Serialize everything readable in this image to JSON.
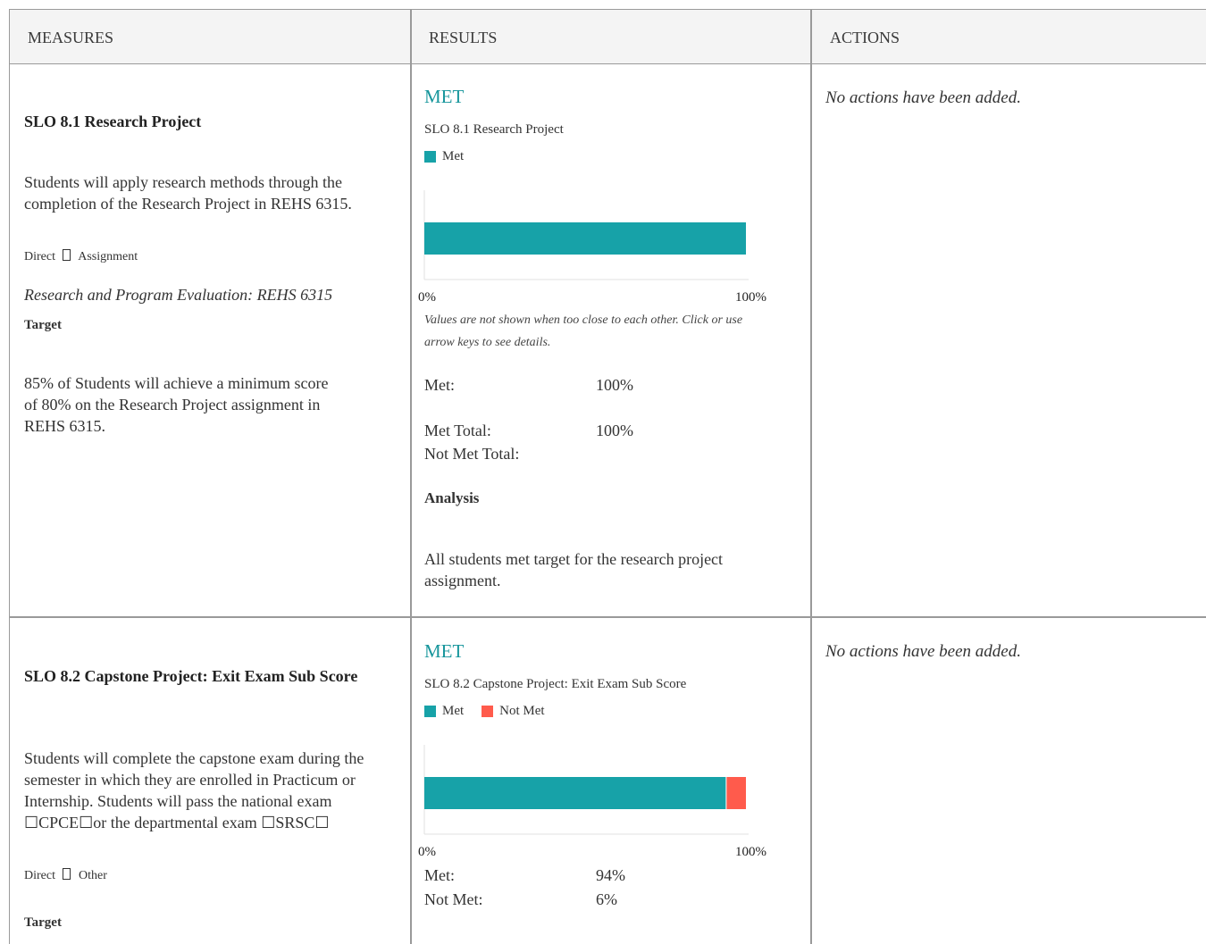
{
  "header": {
    "measures": "MEASURES",
    "results": "RESULTS",
    "actions": "ACTIONS"
  },
  "colors": {
    "met": "#17A2A8",
    "not_met": "#FF5B4C",
    "status": "#17969C"
  },
  "rows": [
    {
      "title": "SLO 8.1 Research Project",
      "description": "Students will apply research methods through the completion of the Research Project in REHS 6315.",
      "type": "Direct",
      "type_icon": "box-icon",
      "type_detail": "Assignment",
      "course": "Research and Program Evaluation: REHS 6315",
      "target_label": "Target",
      "target_text": "85% of Students will achieve a minimum score of 80% on the Research Project assignment in REHS 6315.",
      "status": "MET",
      "chart_title": "SLO 8.1 Research Project",
      "legend": [
        "Met"
      ],
      "axis_min": "0%",
      "axis_max": "100%",
      "note": "Values are not shown when too close to each other.  Click or use arrow keys to see details.",
      "values": [
        {
          "label": "Met:",
          "value": "100%"
        }
      ],
      "totals": [
        {
          "label": "Met Total:",
          "value": "100%"
        },
        {
          "label": "Not Met Total:",
          "value": ""
        }
      ],
      "analysis_label": "Analysis",
      "analysis_text": "All students met target for the research project assignment.",
      "actions": "No actions have been added."
    },
    {
      "title": "SLO 8.2 Capstone Project: Exit Exam Sub Score",
      "description": "Students will complete the capstone exam during the semester in which they are  enrolled in Practicum or Internship. Students will pass the national exam ☐CPCE☐or the departmental exam ☐SRSC☐",
      "type": "Direct",
      "type_icon": "box-icon",
      "type_detail": "Other",
      "target_label": "Target",
      "status": "MET",
      "chart_title": "SLO 8.2 Capstone Project: Exit Exam Sub  Score",
      "legend": [
        "Met",
        "Not Met"
      ],
      "axis_min": "0%",
      "axis_max": "100%",
      "values": [
        {
          "label": "Met:",
          "value": "94%"
        },
        {
          "label": "Not Met:",
          "value": "6%"
        }
      ],
      "actions": "No actions have been added."
    }
  ],
  "chart_data": [
    {
      "type": "bar",
      "orientation": "horizontal",
      "stacked": true,
      "title": "SLO 8.1 Research Project",
      "categories": [
        ""
      ],
      "series": [
        {
          "name": "Met",
          "values": [
            100
          ]
        }
      ],
      "xlim": [
        0,
        100
      ],
      "tick_labels": [
        "0%",
        "100%"
      ],
      "legend": "top-left",
      "grid": false
    },
    {
      "type": "bar",
      "orientation": "horizontal",
      "stacked": true,
      "title": "SLO 8.2 Capstone Project: Exit Exam Sub  Score",
      "categories": [
        ""
      ],
      "series": [
        {
          "name": "Met",
          "values": [
            94
          ]
        },
        {
          "name": "Not Met",
          "values": [
            6
          ]
        }
      ],
      "xlim": [
        0,
        100
      ],
      "tick_labels": [
        "0%",
        "100%"
      ],
      "legend": "top-left",
      "grid": false
    }
  ]
}
